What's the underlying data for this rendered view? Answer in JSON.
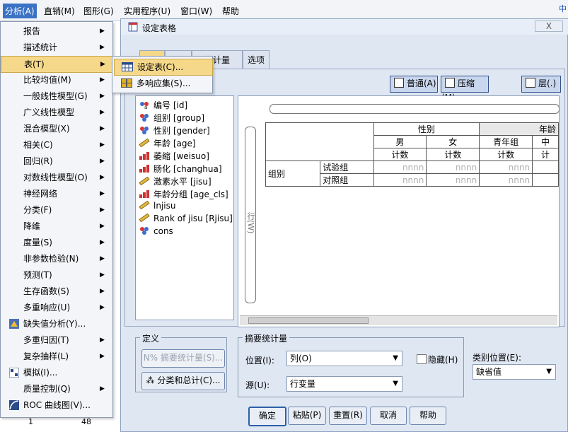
{
  "menubar": {
    "items": [
      "分析(A)",
      "直销(M)",
      "图形(G)",
      "实用程序(U)",
      "窗口(W)",
      "帮助"
    ],
    "extra": "中"
  },
  "bg": {
    "cell_1": "1",
    "cell_2": "48"
  },
  "analysis_menu": {
    "items": [
      {
        "label": "报告",
        "arrow": true
      },
      {
        "label": "描述统计",
        "arrow": true
      },
      {
        "label": "表(T)",
        "arrow": true,
        "highlight": true
      },
      {
        "label": "比较均值(M)",
        "arrow": true
      },
      {
        "label": "一般线性模型(G)",
        "arrow": true
      },
      {
        "label": "广义线性模型",
        "arrow": true
      },
      {
        "label": "混合模型(X)",
        "arrow": true
      },
      {
        "label": "相关(C)",
        "arrow": true
      },
      {
        "label": "回归(R)",
        "arrow": true
      },
      {
        "label": "对数线性模型(O)",
        "arrow": true
      },
      {
        "label": "神经网络",
        "arrow": true
      },
      {
        "label": "分类(F)",
        "arrow": true
      },
      {
        "label": "降维",
        "arrow": true
      },
      {
        "label": "度量(S)",
        "arrow": true
      },
      {
        "label": "非参数检验(N)",
        "arrow": true
      },
      {
        "label": "预测(T)",
        "arrow": true
      },
      {
        "label": "生存函数(S)",
        "arrow": true
      },
      {
        "label": "多重响应(U)",
        "arrow": true
      },
      {
        "label": "缺失值分析(Y)...",
        "arrow": false,
        "icon": "missing-value-icon"
      },
      {
        "label": "多重归因(T)",
        "arrow": true
      },
      {
        "label": "复杂抽样(L)",
        "arrow": true
      },
      {
        "label": "模拟(I)...",
        "arrow": false,
        "icon": "simulation-icon"
      },
      {
        "label": "质量控制(Q)",
        "arrow": true
      },
      {
        "label": "ROC 曲线图(V)...",
        "arrow": false,
        "icon": "roc-curve-icon"
      }
    ]
  },
  "tables_submenu": {
    "items": [
      {
        "label": "设定表(C)...",
        "highlight": true
      },
      {
        "label": "多响应集(S)...",
        "highlight": false
      }
    ]
  },
  "dialog": {
    "title": "设定表格",
    "close": "X",
    "tabs": [
      "",
      "",
      "统计量",
      "选项"
    ],
    "view_buttons": {
      "normal": "普通(A)",
      "compact": "压缩(M)",
      "layers": "层(.)"
    },
    "variables": [
      {
        "label": "编号 [id]",
        "icon": "nominal-icon"
      },
      {
        "label": "组别 [group]",
        "icon": "nominal-set-icon"
      },
      {
        "label": "性别 [gender]",
        "icon": "nominal-set-icon"
      },
      {
        "label": "年龄 [age]",
        "icon": "scale-ruler-icon"
      },
      {
        "label": "萎缩 [weisuo]",
        "icon": "ordinal-bar-icon"
      },
      {
        "label": "肠化 [changhua]",
        "icon": "ordinal-bar-icon"
      },
      {
        "label": "激素水平 [jisu]",
        "icon": "scale-ruler-icon"
      },
      {
        "label": "年龄分组 [age_cls]",
        "icon": "ordinal-bar-icon"
      },
      {
        "label": "lnjisu",
        "icon": "scale-ruler-icon"
      },
      {
        "label": "Rank of jisu [Rjisu]",
        "icon": "scale-ruler-icon"
      },
      {
        "label": "cons",
        "icon": "nominal-set-icon"
      }
    ],
    "canvas": {
      "row_zone_label": "行(W)",
      "header1": {
        "gender": "性别",
        "age": "年龄"
      },
      "header2": [
        "男",
        "女",
        "青年组",
        "中"
      ],
      "header3": [
        "计数",
        "计数",
        "计数",
        "计"
      ],
      "row_group": "组别",
      "rows": [
        {
          "label": "试验组",
          "cells": [
            "nnnn",
            "nnnn",
            "nnnn"
          ]
        },
        {
          "label": "对照组",
          "cells": [
            "nnnn",
            "nnnn",
            "nnnn"
          ]
        }
      ]
    },
    "define": {
      "legend": "定义",
      "summary_btn": "N% 摘要统计量(S)...",
      "cat_btn": "分类和总计(C)..."
    },
    "summary": {
      "legend": "摘要统计量",
      "position_label": "位置(I):",
      "position_value": "列(O)",
      "hide_label": "隐藏(H)",
      "source_label": "源(U):",
      "source_value": "行变量"
    },
    "category_position": {
      "label": "类别位置(E):",
      "value": "缺省值"
    },
    "footer": {
      "ok": "确定",
      "paste": "粘贴(P)",
      "reset": "重置(R)",
      "cancel": "取消",
      "help": "帮助"
    }
  }
}
